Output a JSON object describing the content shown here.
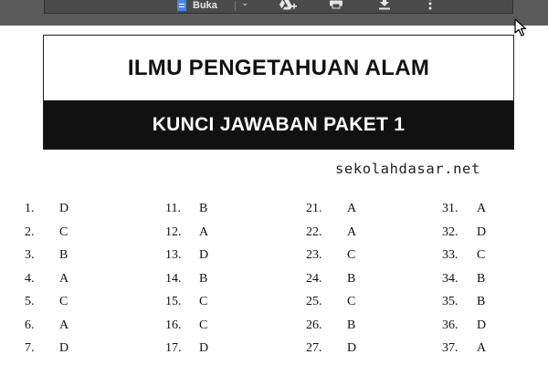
{
  "toolbar": {
    "open_label": "Buka",
    "chevron_icon": "chevron-down-icon",
    "drive_icon": "add-to-drive-icon",
    "print_icon": "print-icon",
    "download_icon": "download-icon",
    "more_icon": "more-vert-icon"
  },
  "document": {
    "title": "ILMU PENGETAHUAN ALAM",
    "subtitle": "KUNCI JAWABAN PAKET 1",
    "site": "sekolahdasar.net",
    "columns": [
      [
        {
          "num": "1.",
          "answer": "D"
        },
        {
          "num": "2.",
          "answer": "C"
        },
        {
          "num": "3.",
          "answer": "B"
        },
        {
          "num": "4.",
          "answer": "A"
        },
        {
          "num": "5.",
          "answer": "C"
        },
        {
          "num": "6.",
          "answer": "A"
        },
        {
          "num": "7.",
          "answer": "D"
        }
      ],
      [
        {
          "num": "11.",
          "answer": "B"
        },
        {
          "num": "12.",
          "answer": "A"
        },
        {
          "num": "13.",
          "answer": "D"
        },
        {
          "num": "14.",
          "answer": "B"
        },
        {
          "num": "15.",
          "answer": "C"
        },
        {
          "num": "16.",
          "answer": "C"
        },
        {
          "num": "17.",
          "answer": "D"
        }
      ],
      [
        {
          "num": "21.",
          "answer": "A"
        },
        {
          "num": "22.",
          "answer": "A"
        },
        {
          "num": "23.",
          "answer": "C"
        },
        {
          "num": "24.",
          "answer": "B"
        },
        {
          "num": "25.",
          "answer": "C"
        },
        {
          "num": "26.",
          "answer": "B"
        },
        {
          "num": "27.",
          "answer": "D"
        }
      ],
      [
        {
          "num": "31.",
          "answer": "A"
        },
        {
          "num": "32.",
          "answer": "D"
        },
        {
          "num": "33.",
          "answer": "C"
        },
        {
          "num": "34.",
          "answer": "B"
        },
        {
          "num": "35.",
          "answer": "B"
        },
        {
          "num": "36.",
          "answer": "D"
        },
        {
          "num": "37.",
          "answer": "A"
        }
      ]
    ]
  }
}
